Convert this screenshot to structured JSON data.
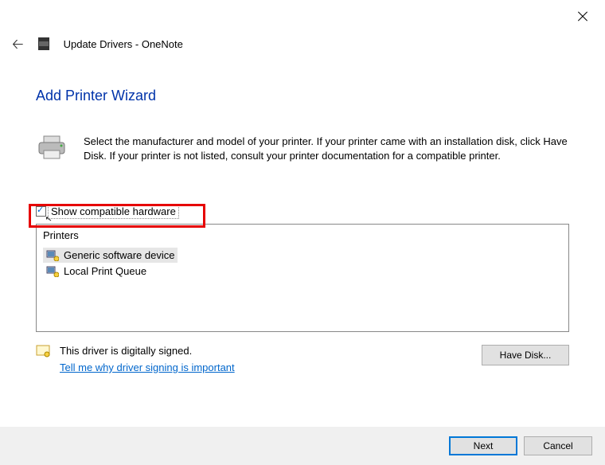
{
  "window": {
    "title": "Update Drivers - OneNote"
  },
  "wizard": {
    "heading": "Add Printer Wizard",
    "description": "Select the manufacturer and model of your printer. If your printer came with an installation disk, click Have Disk. If your printer is not listed, consult your printer documentation for a compatible printer."
  },
  "checkbox": {
    "label": "Show compatible hardware",
    "checked": true
  },
  "list": {
    "header": "Printers",
    "items": [
      {
        "label": "Generic software device",
        "selected": true
      },
      {
        "label": "Local Print Queue",
        "selected": false
      }
    ]
  },
  "signing": {
    "status": "This driver is digitally signed.",
    "link": "Tell me why driver signing is important"
  },
  "buttons": {
    "have_disk": "Have Disk...",
    "next": "Next",
    "cancel": "Cancel"
  }
}
